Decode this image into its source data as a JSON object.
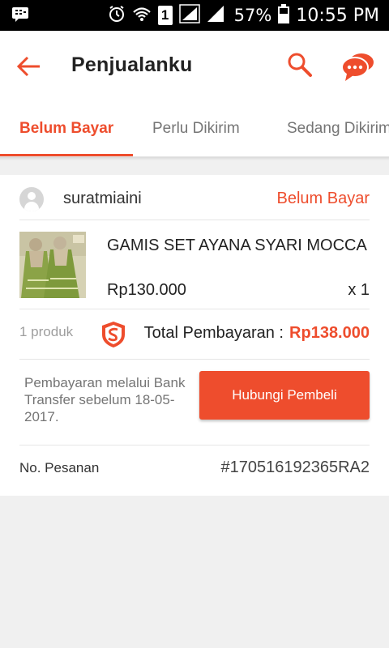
{
  "status_bar": {
    "battery": "57%",
    "time": "10:55 PM",
    "sim_slot": "1",
    "icons": [
      "bbm-icon",
      "alarm-icon",
      "wifi-icon",
      "signal-icon",
      "battery-icon"
    ]
  },
  "header": {
    "title": "Penjualanku",
    "icons": [
      "back-arrow-icon",
      "search-icon",
      "chat-icon"
    ]
  },
  "tabs": [
    {
      "label": "Belum Bayar",
      "active": true
    },
    {
      "label": "Perlu Dikirim",
      "active": false
    },
    {
      "label": "Sedang Dikirim",
      "active": false
    }
  ],
  "order": {
    "buyer": "suratmiaini",
    "status": "Belum Bayar",
    "product": {
      "name": "GAMIS SET AYANA SYARI MOCCA",
      "price": "Rp130.000",
      "quantity": "x 1"
    },
    "product_count": "1 produk",
    "total_label": "Total Pembayaran :",
    "total_value": "Rp138.000",
    "payment_info": "Pembayaran melalui Bank Transfer sebelum 18-05-2017.",
    "contact_button": "Hubungi Pembeli",
    "order_no_label": "No. Pesanan",
    "order_no_value": "#170516192365RA2"
  },
  "colors": {
    "accent": "#ee4d2d",
    "background": "#f0f0f0"
  }
}
